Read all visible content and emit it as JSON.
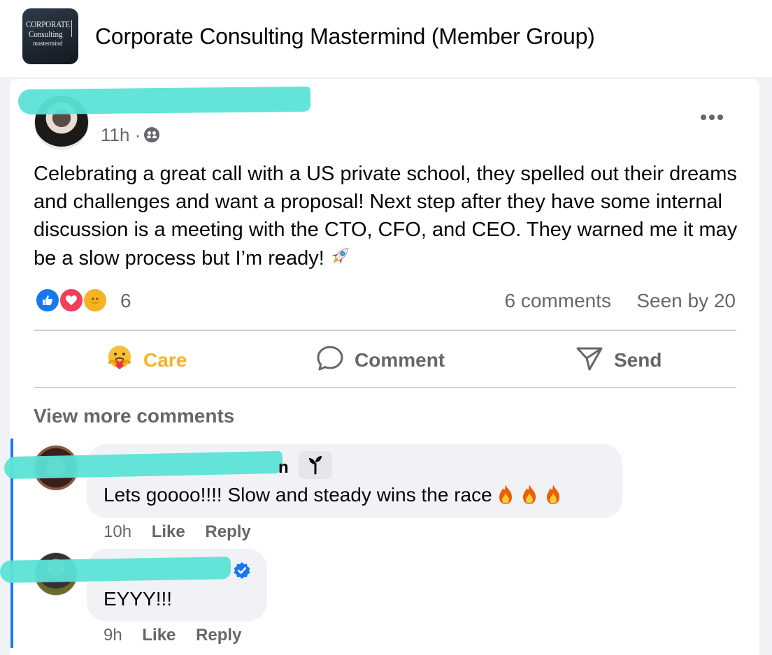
{
  "group": {
    "logo_line1": "CORPORATE",
    "logo_line2": "Consulting",
    "logo_line3": "mastermind",
    "title": "Corporate Consulting Mastermind (Member Group)"
  },
  "post": {
    "time": "11h ·",
    "body": "Celebrating a great call with a US private school, they spelled out their dreams and challenges and want a proposal!  Next step after they have some internal discussion is a meeting with the CTO, CFO, and CEO. They warned me it may be a slow process but I’m ready!",
    "reaction_count": "6",
    "comments_count": "6 comments",
    "seen_by": "Seen by 20"
  },
  "actions": {
    "care": "Care",
    "comment": "Comment",
    "send": "Send"
  },
  "comments_section": {
    "view_more": "View more comments",
    "items": [
      {
        "name_tail": "n",
        "text": "Lets goooo!!!! Slow and steady wins the race",
        "time": "10h",
        "like": "Like",
        "reply": "Reply"
      },
      {
        "text": "EYYY!!!",
        "time": "9h",
        "like": "Like",
        "reply": "Reply"
      }
    ]
  },
  "colors": {
    "accent_blue": "#1877f2",
    "care_yellow": "#f7b125",
    "redaction": "#5ce1d6",
    "secondary_text": "#65676b"
  }
}
